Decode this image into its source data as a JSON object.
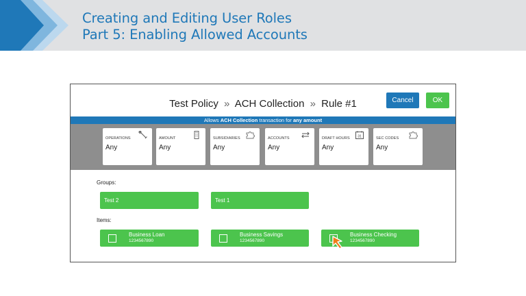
{
  "header": {
    "title_line1": "Creating and Editing User Roles",
    "title_line2": "Part 5: Enabling Allowed Accounts",
    "brand_color": "#1f78b8"
  },
  "dialog": {
    "breadcrumb": [
      "Test Policy",
      "ACH Collection",
      "Rule #1"
    ],
    "separator": "»",
    "cancel_label": "Cancel",
    "ok_label": "OK",
    "rule_summary": {
      "prefix": "Allows",
      "transaction": "ACH Collection",
      "middle": "transaction for",
      "amount": "any amount"
    },
    "cards": [
      {
        "label": "OPERATIONS",
        "value": "Any",
        "icon": "wrench-icon"
      },
      {
        "label": "AMOUNT",
        "value": "Any",
        "icon": "building-icon"
      },
      {
        "label": "SUBSIDIARIES",
        "value": "Any",
        "icon": "puzzle-icon"
      },
      {
        "label": "ACCOUNTS",
        "value": "Any",
        "icon": "transfer-arrows-icon"
      },
      {
        "label": "DRAFT HOURS",
        "value": "Any",
        "icon": "calendar-icon",
        "icon_text": "31"
      },
      {
        "label": "SEC CODES",
        "value": "Any",
        "icon": "puzzle-icon"
      }
    ],
    "groups_label": "Groups:",
    "groups": [
      "Test 2",
      "Test 1"
    ],
    "items_label": "Items:",
    "items": [
      {
        "name": "Business Loan",
        "number": "1234567890",
        "checked": false
      },
      {
        "name": "Business Savings",
        "number": "1234567890",
        "checked": false
      },
      {
        "name": "Business Checking",
        "number": "1234567890",
        "checked": false
      }
    ],
    "accent_green": "#4cc44d",
    "cursor_color": "#f07d1a"
  }
}
